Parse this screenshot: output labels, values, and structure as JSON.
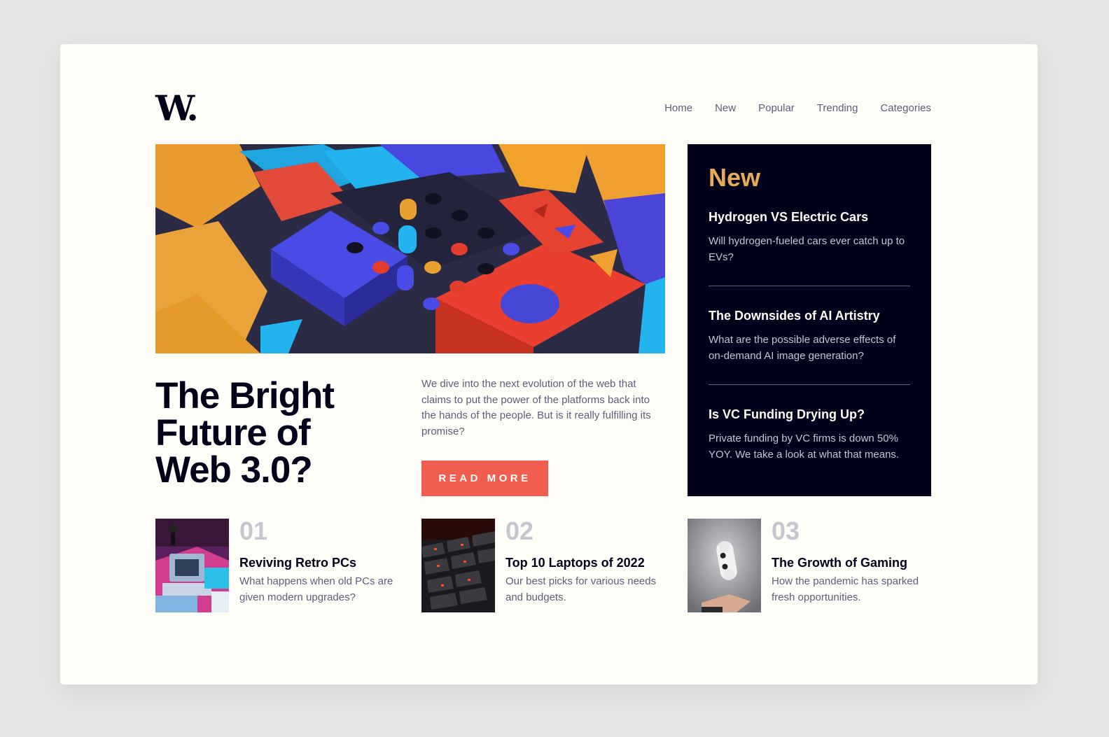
{
  "header": {
    "logo": "W.",
    "nav": [
      "Home",
      "New",
      "Popular",
      "Trending",
      "Categories"
    ]
  },
  "hero": {
    "title": "The Bright Future of Web 3.0?",
    "description": "We dive into the next evolution of the web that claims to put the power of the platforms back into the hands of the people. But is it really fulfilling its promise?",
    "button_label": "READ MORE"
  },
  "new_panel": {
    "heading": "New",
    "items": [
      {
        "title": "Hydrogen VS Electric Cars",
        "text": "Will hydrogen-fueled cars ever catch up to EVs?"
      },
      {
        "title": "The Downsides of AI Artistry",
        "text": "What are the possible adverse effects of on-demand AI image generation?"
      },
      {
        "title": "Is VC Funding Drying Up?",
        "text": "Private funding by VC firms is down 50% YOY. We take a look at what that means."
      }
    ]
  },
  "bottom": [
    {
      "num": "01",
      "title": "Reviving Retro PCs",
      "text": "What happens when old PCs are given modern upgrades?"
    },
    {
      "num": "02",
      "title": "Top 10 Laptops of 2022",
      "text": "Our best picks for various needs and budgets."
    },
    {
      "num": "03",
      "title": "The Growth of Gaming",
      "text": "How the pandemic has sparked fresh opportunities."
    }
  ],
  "colors": {
    "background": "#fffdf8",
    "dark": "#00001a",
    "accent_red": "#f15e50",
    "accent_orange": "#e9ab53",
    "muted": "#5d5f79",
    "light_gray": "#c5c6ce"
  }
}
